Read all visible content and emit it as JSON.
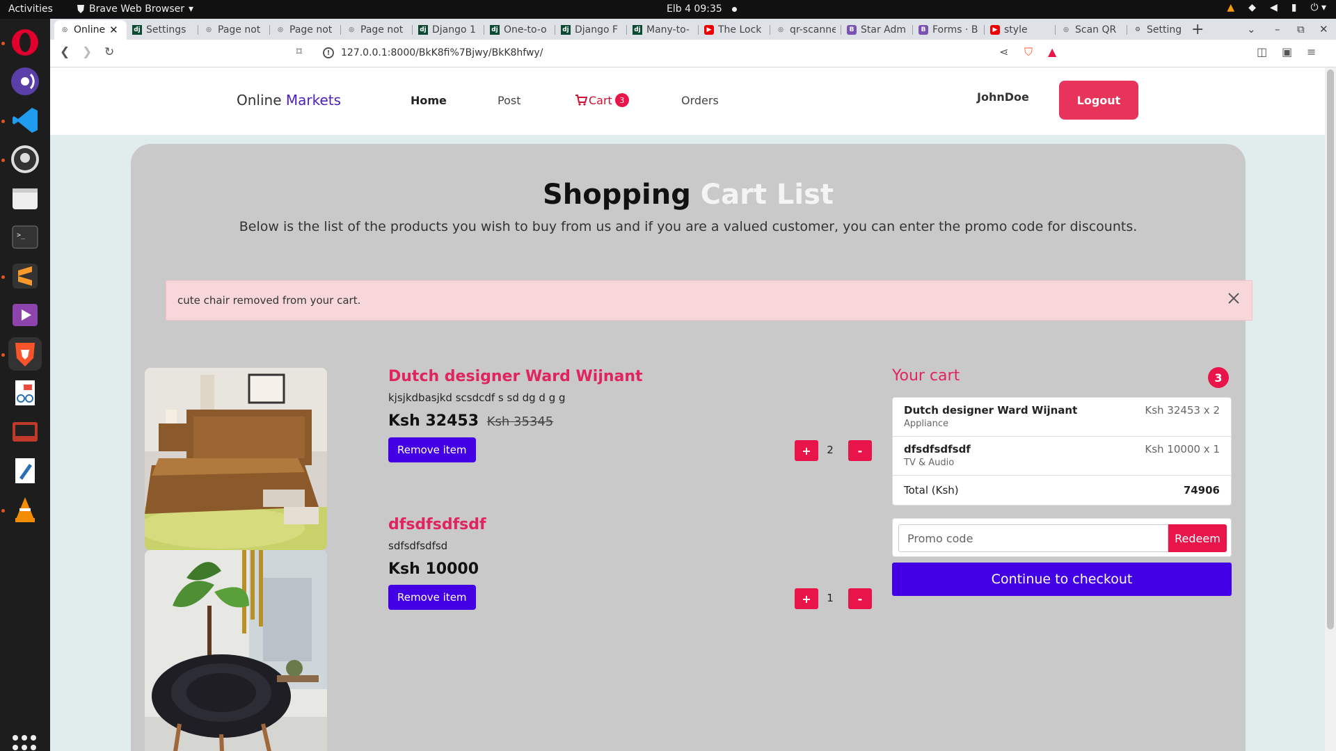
{
  "system": {
    "activities": "Activities",
    "app_menu": "Brave Web Browser",
    "clock": "Elb 4  09:35"
  },
  "browser": {
    "tabs": [
      {
        "label": "Online",
        "icon": "globe-icon",
        "active": true
      },
      {
        "label": "Settings",
        "icon": "django-icon"
      },
      {
        "label": "Page not",
        "icon": "globe-icon"
      },
      {
        "label": "Page not",
        "icon": "globe-icon"
      },
      {
        "label": "Page not",
        "icon": "globe-icon"
      },
      {
        "label": "Django 1",
        "icon": "django-icon"
      },
      {
        "label": "One-to-o",
        "icon": "django-icon"
      },
      {
        "label": "Django F",
        "icon": "django-icon"
      },
      {
        "label": "Many-to-",
        "icon": "django-icon"
      },
      {
        "label": "The Lock",
        "icon": "youtube-icon"
      },
      {
        "label": "qr-scanne",
        "icon": "globe-icon"
      },
      {
        "label": "Star Adm",
        "icon": "bootstrap-icon"
      },
      {
        "label": "Forms · B",
        "icon": "bootstrap-icon"
      },
      {
        "label": "style",
        "icon": "youtube-icon"
      },
      {
        "label": "Scan QR",
        "icon": "globe-icon"
      },
      {
        "label": "Settings",
        "icon": "gear-icon"
      }
    ],
    "url": "127.0.0.1:8000/BkK8fi%7Bjwy/BkK8hfwy/"
  },
  "nav": {
    "brand_main": "Online ",
    "brand_accent": "Markets",
    "home": "Home",
    "post": "Post",
    "cart": "Cart",
    "cart_badge": "3",
    "orders": "Orders",
    "username": "JohnDoe",
    "logout": "Logout"
  },
  "heading": {
    "title_dark": "Shopping ",
    "title_light": "Cart List",
    "subtitle": "Below is the list of the products you wish to buy from us and if you are a valued customer, you can enter the promo code for discounts."
  },
  "alert": {
    "message": "cute chair removed from your cart."
  },
  "items": [
    {
      "name": "Dutch designer Ward Wijnant",
      "description": "kjsjkdbasjkd scsdcdf s sd dg d g g",
      "price": "Ksh 32453",
      "old_price": "Ksh 35345",
      "remove_label": "Remove item",
      "quantity": "2",
      "plus": "+",
      "minus": "-"
    },
    {
      "name": "dfsdfsdfsdf",
      "description": "sdfsdfsdfsd",
      "price": "Ksh 10000",
      "remove_label": "Remove item",
      "quantity": "1",
      "plus": "+",
      "minus": "-"
    }
  ],
  "cart_summary": {
    "heading": "Your cart",
    "count": "3",
    "lines": [
      {
        "name": "Dutch designer Ward Wijnant",
        "category": "Appliance",
        "price": "Ksh 32453 x 2"
      },
      {
        "name": "dfsdfsdfsdf",
        "category": "TV & Audio",
        "price": "Ksh 10000 x 1"
      }
    ],
    "total_label": "Total (Ksh)",
    "total_value": "74906",
    "promo_placeholder": "Promo code",
    "redeem": "Redeem",
    "checkout": "Continue to checkout"
  },
  "colors": {
    "accent_pink": "#e8144a",
    "accent_purple": "#4400e5",
    "brand_purple": "#4b1fb8"
  }
}
